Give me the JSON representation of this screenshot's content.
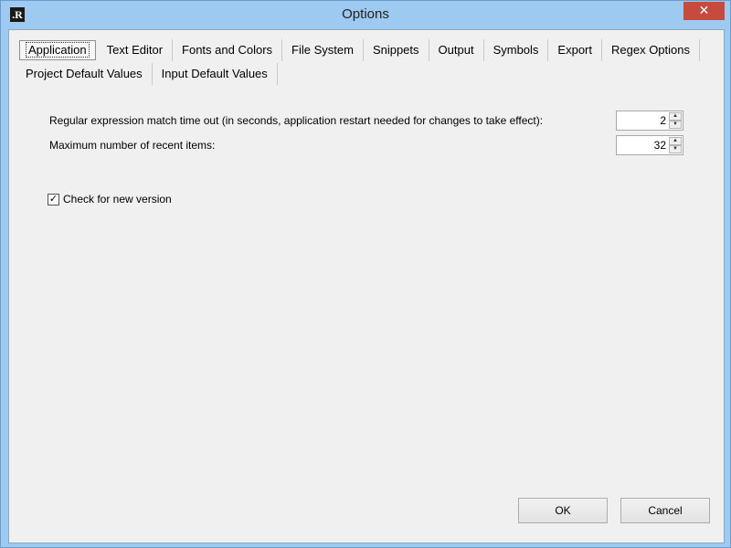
{
  "window": {
    "title": "Options",
    "icon_text": ".R",
    "close_glyph": "✕"
  },
  "tabs": {
    "row1": [
      "Application",
      "Text Editor",
      "Fonts and Colors",
      "File System",
      "Snippets",
      "Output",
      "Symbols",
      "Export",
      "Regex Options"
    ],
    "row2": [
      "Project Default Values",
      "Input Default Values"
    ],
    "selected": "Application"
  },
  "settings": {
    "timeout_label": "Regular expression match time out (in seconds, application restart needed for changes to take effect):",
    "timeout_value": "2",
    "recent_label": "Maximum number of recent items:",
    "recent_value": "32",
    "check_version_label": "Check for new version",
    "check_version_checked": true
  },
  "buttons": {
    "ok": "OK",
    "cancel": "Cancel"
  }
}
